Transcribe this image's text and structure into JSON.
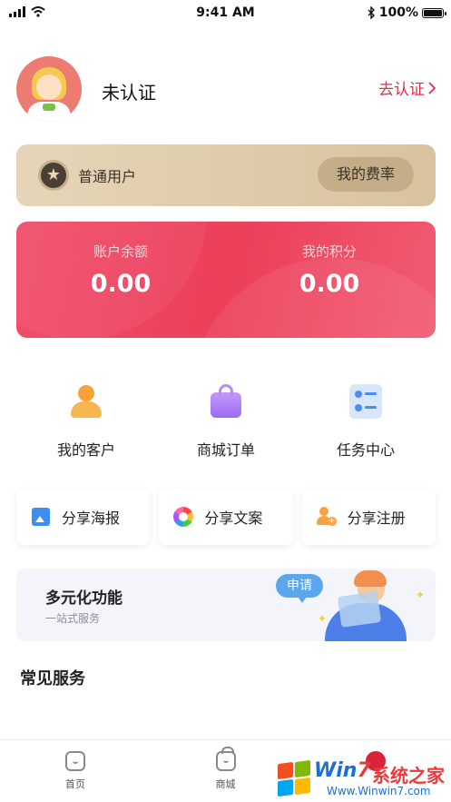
{
  "status_bar": {
    "time": "9:41 AM",
    "battery": "100%"
  },
  "profile": {
    "name": "未认证",
    "verify_label": "去认证",
    "verify_chevron": "chevron-right-icon"
  },
  "member": {
    "level": "普通用户",
    "rate_button": "我的费率"
  },
  "balance": {
    "balance_label": "账户余额",
    "balance_value": "0.00",
    "points_label": "我的积分",
    "points_value": "0.00",
    "accent": "#ee4462"
  },
  "quick_actions": [
    {
      "label": "我的客户",
      "icon": "customer-icon"
    },
    {
      "label": "商城订单",
      "icon": "shopping-bag-icon"
    },
    {
      "label": "任务中心",
      "icon": "task-icon"
    }
  ],
  "share_actions": [
    {
      "label": "分享海报",
      "icon": "image-icon"
    },
    {
      "label": "分享文案",
      "icon": "aperture-icon"
    },
    {
      "label": "分享注册",
      "icon": "add-user-icon"
    }
  ],
  "banner": {
    "title": "多元化功能",
    "subtitle": "一站式服务",
    "apply_label": "申请"
  },
  "section": {
    "title": "常见服务"
  },
  "tabs": [
    {
      "label": "首页",
      "icon": "home-icon"
    },
    {
      "label": "商城",
      "icon": "mall-icon"
    },
    {
      "label": "",
      "icon": "me-icon"
    }
  ],
  "watermark": {
    "brand_prefix": "Win",
    "brand_num": "7",
    "brand_cn": "系统之家",
    "url": "Www.Winwin7.com"
  }
}
